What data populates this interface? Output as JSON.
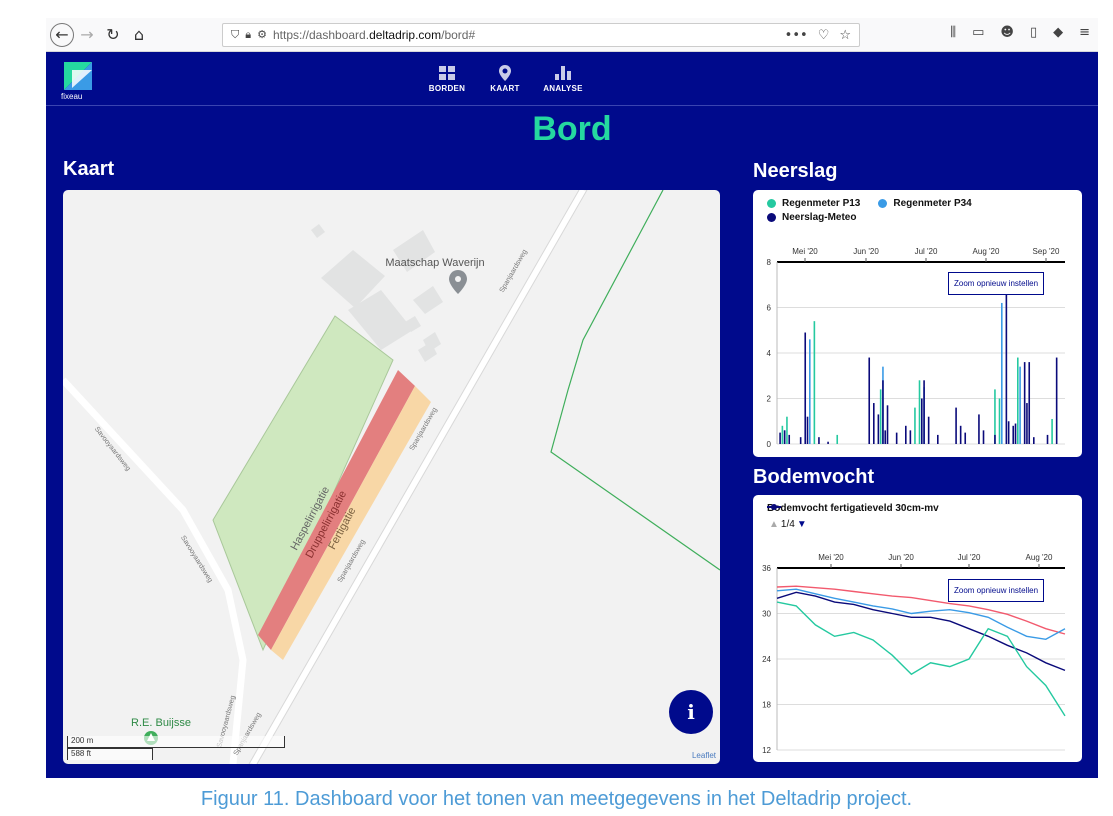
{
  "browser": {
    "url_prefix": "https://dashboard.",
    "url_domain": "deltadrip.com",
    "url_suffix": "/bord#",
    "menu_dots": "•••"
  },
  "app": {
    "logo_text": "fixeau",
    "nav": [
      {
        "label": "BORDEN",
        "icon": "grid-icon"
      },
      {
        "label": "KAART",
        "icon": "map-pin-icon"
      },
      {
        "label": "ANALYSE",
        "icon": "bar-chart-icon"
      }
    ],
    "page_title": "Bord",
    "colors": {
      "brand": "#000a8c",
      "accent": "#25d8a0"
    }
  },
  "map": {
    "title": "Kaart",
    "poi_name": "Maatschap Waverijn",
    "poi2_name": "R.E. Buijsse",
    "fields": [
      "Haspelirrigatie",
      "Druppelirrigatie",
      "Fertigatie"
    ],
    "roads": [
      "Spanjaardsweg",
      "Spanjaardsweg",
      "Spanjaardsweg",
      "Spanjaardsweg",
      "Savooyaardsweg",
      "Savooyaardsweg",
      "Savooyaardsweg"
    ],
    "info_label": "i",
    "attribution": "Leaflet",
    "scale_metric": "200 m",
    "scale_imperial": "588 ft"
  },
  "neerslag": {
    "title": "Neerslag",
    "zoom_reset": "Zoom opnieuw instellen",
    "chart_data": {
      "type": "bar",
      "x_ticks": [
        "Mei '20",
        "Jun '20",
        "Jul '20",
        "Aug '20",
        "Sep '20"
      ],
      "y_ticks": [
        0,
        2,
        4,
        6,
        8
      ],
      "ylim": [
        0,
        8
      ],
      "series": [
        {
          "name": "Regenmeter P13",
          "color": "#25c9a0",
          "points": [
            [
              2,
              0.8
            ],
            [
              4,
              1.2
            ],
            [
              16,
              5.4
            ],
            [
              26,
              0.4
            ],
            [
              45,
              2.4
            ],
            [
              60,
              1.6
            ],
            [
              62,
              2.8
            ],
            [
              95,
              2.4
            ],
            [
              97,
              2.0
            ],
            [
              105,
              3.8
            ],
            [
              120,
              1.1
            ]
          ]
        },
        {
          "name": "Regenmeter P34",
          "color": "#3a9be6",
          "points": [
            [
              3,
              0.6
            ],
            [
              14,
              4.6
            ],
            [
              46,
              3.4
            ],
            [
              64,
              2.5
            ],
            [
              98,
              6.2
            ],
            [
              106,
              3.4
            ]
          ]
        },
        {
          "name": "Neerslag-Meteo",
          "color": "#0a0a7a",
          "points": [
            [
              1,
              0.5
            ],
            [
              3,
              0.6
            ],
            [
              5,
              0.4
            ],
            [
              10,
              0.3
            ],
            [
              12,
              4.9
            ],
            [
              13,
              1.2
            ],
            [
              18,
              0.3
            ],
            [
              22,
              0.1
            ],
            [
              40,
              3.8
            ],
            [
              42,
              1.8
            ],
            [
              44,
              1.3
            ],
            [
              46,
              2.8
            ],
            [
              47,
              0.6
            ],
            [
              48,
              1.7
            ],
            [
              52,
              0.5
            ],
            [
              56,
              0.8
            ],
            [
              58,
              0.6
            ],
            [
              63,
              2.0
            ],
            [
              64,
              2.8
            ],
            [
              66,
              1.2
            ],
            [
              70,
              0.4
            ],
            [
              78,
              1.6
            ],
            [
              80,
              0.8
            ],
            [
              82,
              0.5
            ],
            [
              88,
              1.3
            ],
            [
              90,
              0.6
            ],
            [
              95,
              0.4
            ],
            [
              100,
              6.6
            ],
            [
              101,
              1.0
            ],
            [
              103,
              0.8
            ],
            [
              104,
              0.9
            ],
            [
              108,
              3.6
            ],
            [
              109,
              1.8
            ],
            [
              110,
              3.6
            ],
            [
              112,
              0.3
            ],
            [
              118,
              0.4
            ],
            [
              122,
              3.8
            ]
          ]
        }
      ]
    }
  },
  "bodemvocht": {
    "title": "Bodemvocht",
    "legend": "Bodemvocht fertigatieveld 30cm-mv",
    "pager": "1/4",
    "zoom_reset": "Zoom opnieuw instellen",
    "chart_data": {
      "type": "line",
      "x_ticks": [
        "Mei '20",
        "Jun '20",
        "Jul '20",
        "Aug '20"
      ],
      "y_ticks": [
        12,
        18,
        24,
        30,
        36
      ],
      "ylim": [
        12,
        36
      ],
      "series": [
        {
          "color": "#f25a6e",
          "values": [
            33.5,
            33.6,
            33.4,
            33.2,
            32.9,
            32.6,
            32.3,
            32.1,
            31.7,
            31.3,
            31.0,
            30.5,
            29.9,
            29.0,
            28.0,
            27.3
          ]
        },
        {
          "color": "#3a9be6",
          "values": [
            33.0,
            33.2,
            32.6,
            32.0,
            31.5,
            31.0,
            30.6,
            30.0,
            30.3,
            30.5,
            30.1,
            29.5,
            28.2,
            27.0,
            26.6,
            28.0
          ]
        },
        {
          "color": "#0a0a7a",
          "values": [
            32.0,
            32.8,
            32.3,
            31.5,
            31.2,
            30.5,
            30.0,
            29.5,
            29.5,
            29.0,
            28.0,
            27.0,
            25.8,
            24.8,
            23.5,
            22.5
          ]
        },
        {
          "color": "#25c9a0",
          "values": [
            31.5,
            31.0,
            28.5,
            27.0,
            27.5,
            26.5,
            24.5,
            22.0,
            23.5,
            23.0,
            24.0,
            28.0,
            27.0,
            23.0,
            20.5,
            16.5
          ]
        }
      ]
    }
  },
  "caption": "Figuur 11. Dashboard voor het tonen van meetgegevens in het Deltadrip project."
}
